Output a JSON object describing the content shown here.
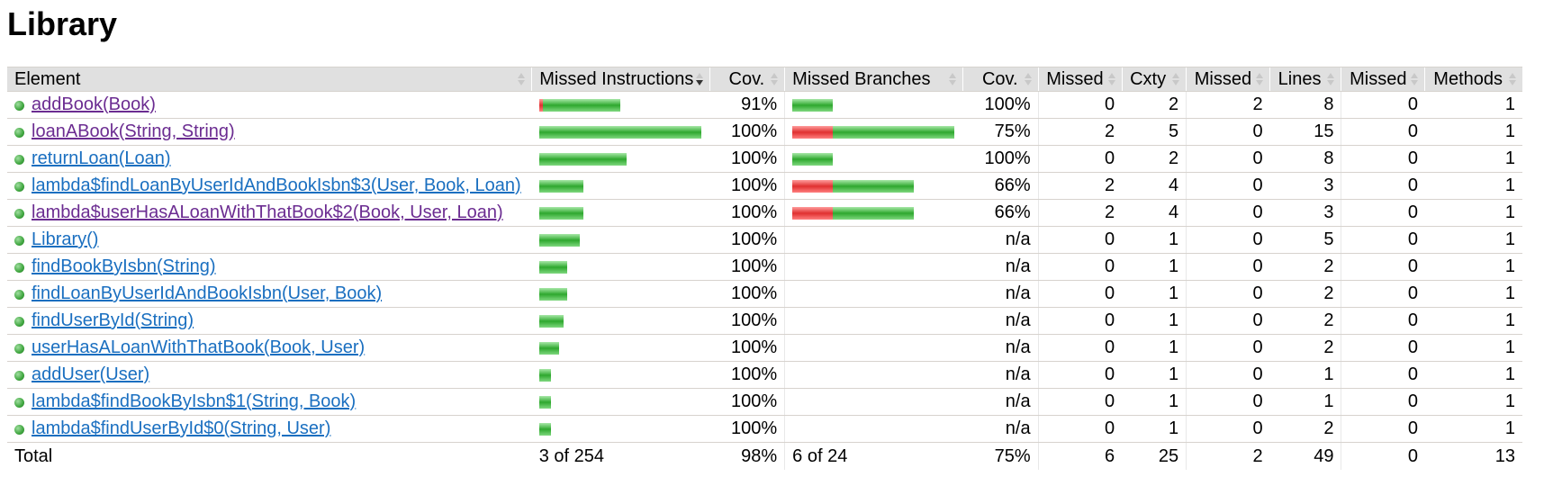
{
  "page_title": "Library",
  "header": {
    "element": "Element",
    "missed_instructions": "Missed Instructions",
    "cov1": "Cov.",
    "missed_branches": "Missed Branches",
    "cov2": "Cov.",
    "missed_cxty": "Missed",
    "cxty": "Cxty",
    "missed_lines": "Missed",
    "lines": "Lines",
    "missed_methods": "Missed",
    "methods": "Methods"
  },
  "colors": {
    "link": "#1a6fc0",
    "visited_link": "#6b2c91",
    "bar_red": "#e03030",
    "bar_green": "#2ea82e",
    "header_bg": "#e0e0e0"
  },
  "rows": [
    {
      "name": "addBook(Book)",
      "visited": true,
      "instr_missed_frac": 0.04,
      "instr_total_rel": 0.5,
      "instr_cov": "91%",
      "br_missed_frac": 0.0,
      "br_total_rel": 0.25,
      "br_cov": "100%",
      "cxty_missed": "0",
      "cxty": "2",
      "lines_missed": "2",
      "lines": "8",
      "methods_missed": "0",
      "methods": "1"
    },
    {
      "name": "loanABook(String, String)",
      "visited": true,
      "instr_missed_frac": 0.0,
      "instr_total_rel": 1.0,
      "instr_cov": "100%",
      "br_missed_frac": 0.25,
      "br_total_rel": 1.0,
      "br_cov": "75%",
      "cxty_missed": "2",
      "cxty": "5",
      "lines_missed": "0",
      "lines": "15",
      "methods_missed": "0",
      "methods": "1"
    },
    {
      "name": "returnLoan(Loan)",
      "visited": false,
      "instr_missed_frac": 0.0,
      "instr_total_rel": 0.54,
      "instr_cov": "100%",
      "br_missed_frac": 0.0,
      "br_total_rel": 0.25,
      "br_cov": "100%",
      "cxty_missed": "0",
      "cxty": "2",
      "lines_missed": "0",
      "lines": "8",
      "methods_missed": "0",
      "methods": "1"
    },
    {
      "name": "lambda$findLoanByUserIdAndBookIsbn$3(User, Book, Loan)",
      "visited": false,
      "instr_missed_frac": 0.0,
      "instr_total_rel": 0.27,
      "instr_cov": "100%",
      "br_missed_frac": 0.33,
      "br_total_rel": 0.75,
      "br_cov": "66%",
      "cxty_missed": "2",
      "cxty": "4",
      "lines_missed": "0",
      "lines": "3",
      "methods_missed": "0",
      "methods": "1"
    },
    {
      "name": "lambda$userHasALoanWithThatBook$2(Book, User, Loan)",
      "visited": true,
      "instr_missed_frac": 0.0,
      "instr_total_rel": 0.27,
      "instr_cov": "100%",
      "br_missed_frac": 0.33,
      "br_total_rel": 0.75,
      "br_cov": "66%",
      "cxty_missed": "2",
      "cxty": "4",
      "lines_missed": "0",
      "lines": "3",
      "methods_missed": "0",
      "methods": "1"
    },
    {
      "name": "Library()",
      "visited": false,
      "instr_missed_frac": 0.0,
      "instr_total_rel": 0.25,
      "instr_cov": "100%",
      "br_missed_frac": null,
      "br_total_rel": null,
      "br_cov": "n/a",
      "cxty_missed": "0",
      "cxty": "1",
      "lines_missed": "0",
      "lines": "5",
      "methods_missed": "0",
      "methods": "1"
    },
    {
      "name": "findBookByIsbn(String)",
      "visited": false,
      "instr_missed_frac": 0.0,
      "instr_total_rel": 0.17,
      "instr_cov": "100%",
      "br_missed_frac": null,
      "br_total_rel": null,
      "br_cov": "n/a",
      "cxty_missed": "0",
      "cxty": "1",
      "lines_missed": "0",
      "lines": "2",
      "methods_missed": "0",
      "methods": "1"
    },
    {
      "name": "findLoanByUserIdAndBookIsbn(User, Book)",
      "visited": false,
      "instr_missed_frac": 0.0,
      "instr_total_rel": 0.17,
      "instr_cov": "100%",
      "br_missed_frac": null,
      "br_total_rel": null,
      "br_cov": "n/a",
      "cxty_missed": "0",
      "cxty": "1",
      "lines_missed": "0",
      "lines": "2",
      "methods_missed": "0",
      "methods": "1"
    },
    {
      "name": "findUserById(String)",
      "visited": false,
      "instr_missed_frac": 0.0,
      "instr_total_rel": 0.15,
      "instr_cov": "100%",
      "br_missed_frac": null,
      "br_total_rel": null,
      "br_cov": "n/a",
      "cxty_missed": "0",
      "cxty": "1",
      "lines_missed": "0",
      "lines": "2",
      "methods_missed": "0",
      "methods": "1"
    },
    {
      "name": "userHasALoanWithThatBook(Book, User)",
      "visited": false,
      "instr_missed_frac": 0.0,
      "instr_total_rel": 0.12,
      "instr_cov": "100%",
      "br_missed_frac": null,
      "br_total_rel": null,
      "br_cov": "n/a",
      "cxty_missed": "0",
      "cxty": "1",
      "lines_missed": "0",
      "lines": "2",
      "methods_missed": "0",
      "methods": "1"
    },
    {
      "name": "addUser(User)",
      "visited": false,
      "instr_missed_frac": 0.0,
      "instr_total_rel": 0.07,
      "instr_cov": "100%",
      "br_missed_frac": null,
      "br_total_rel": null,
      "br_cov": "n/a",
      "cxty_missed": "0",
      "cxty": "1",
      "lines_missed": "0",
      "lines": "1",
      "methods_missed": "0",
      "methods": "1"
    },
    {
      "name": "lambda$findBookByIsbn$1(String, Book)",
      "visited": false,
      "instr_missed_frac": 0.0,
      "instr_total_rel": 0.07,
      "instr_cov": "100%",
      "br_missed_frac": null,
      "br_total_rel": null,
      "br_cov": "n/a",
      "cxty_missed": "0",
      "cxty": "1",
      "lines_missed": "0",
      "lines": "1",
      "methods_missed": "0",
      "methods": "1"
    },
    {
      "name": "lambda$findUserById$0(String, User)",
      "visited": false,
      "instr_missed_frac": 0.0,
      "instr_total_rel": 0.07,
      "instr_cov": "100%",
      "br_missed_frac": null,
      "br_total_rel": null,
      "br_cov": "n/a",
      "cxty_missed": "0",
      "cxty": "1",
      "lines_missed": "0",
      "lines": "2",
      "methods_missed": "0",
      "methods": "1"
    }
  ],
  "total": {
    "label": "Total",
    "instructions": "3 of 254",
    "instr_cov": "98%",
    "branches": "6 of 24",
    "br_cov": "75%",
    "cxty_missed": "6",
    "cxty": "25",
    "lines_missed": "2",
    "lines": "49",
    "methods_missed": "0",
    "methods": "13"
  }
}
